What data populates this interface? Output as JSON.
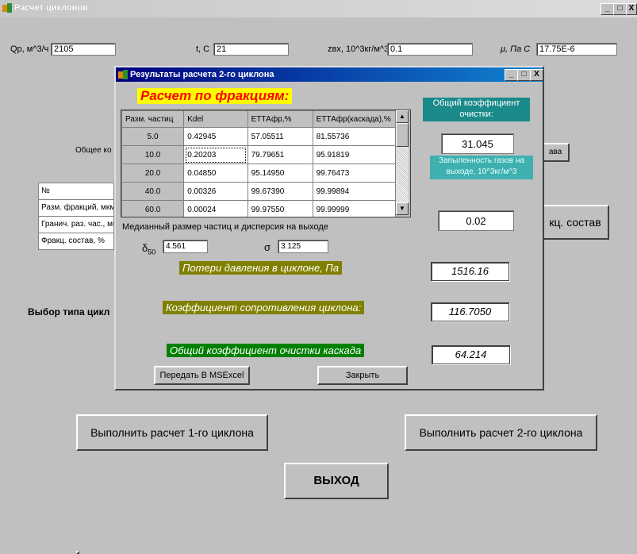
{
  "window": {
    "title": "Расчет циклонов",
    "minimize": "_",
    "maximize": "□",
    "close": "X"
  },
  "params": {
    "q_label": "Qр, м^3/ч",
    "q_value": "2105",
    "t_label": "t, С",
    "t_value": "21",
    "zvx_label": "zвх, 10^3кг/м^3",
    "zvx_value": "0.1",
    "mu_label": "μ, Па С",
    "mu_value": "17.75E-6"
  },
  "background": {
    "obshee_label": "Общее ко",
    "btn_sostava_partial": "ава",
    "table_rows": [
      "№",
      "Разм. фракций, мкм",
      "Гранич. раз. час., мкм",
      "Фракц. состав, %"
    ],
    "frakc_sostav_btn": "кц. состав",
    "vybor_label": "Выбор типа цикл",
    "run1_label": "Выполнить расчет 1-го циклона",
    "run2_label": "Выполнить расчет 2-го циклона",
    "exit_label": "ВЫХОД"
  },
  "dialog": {
    "title": "Результаты расчета 2-го циклона",
    "header": "Расчет по фракциям:",
    "columns": [
      "Разм. частиц",
      "Kdel",
      "ЕТТАфр,%",
      "ЕТТАфр(каскада),%"
    ],
    "rows": [
      [
        "5.0",
        "0.42945",
        "57.05511",
        "81.55736"
      ],
      [
        "10.0",
        "0.20203",
        "79.79651",
        "95.91819"
      ],
      [
        "20.0",
        "0.04850",
        "95.14950",
        "99.76473"
      ],
      [
        "40.0",
        "0.00326",
        "99.67390",
        "99.99894"
      ],
      [
        "60.0",
        "0.00024",
        "99.97550",
        "99.99999"
      ]
    ],
    "median_label": "Медианный размер частиц и дисперсия на выходе",
    "d50_symbol": "δ",
    "d50_sub": "50",
    "d50_value": "4.561",
    "sigma_symbol": "σ",
    "sigma_value": "3.125",
    "total_coef_label": "Общий коэффициент очистки:",
    "total_coef_value": "31.045",
    "dust_label": "Запыленность газов на выходе, 10^3кг/м^3",
    "dust_value": "0.02",
    "pressure_label": "Потери давления в циклоне,  Па",
    "pressure_value": "1516.16",
    "resist_label": "Коэффициент сопротивления циклона:",
    "resist_value": "116.7050",
    "cascade_label": "Общий коэффициент очистки каскада",
    "cascade_value": "64.214",
    "excel_btn": "Передать В MSExcel",
    "close_btn": "Закрыть",
    "colors": {
      "header_bg": "#ffff00",
      "header_fg": "#ff0000",
      "olive": "#808000",
      "green": "#008000",
      "teal": "#1a8a8a"
    }
  }
}
